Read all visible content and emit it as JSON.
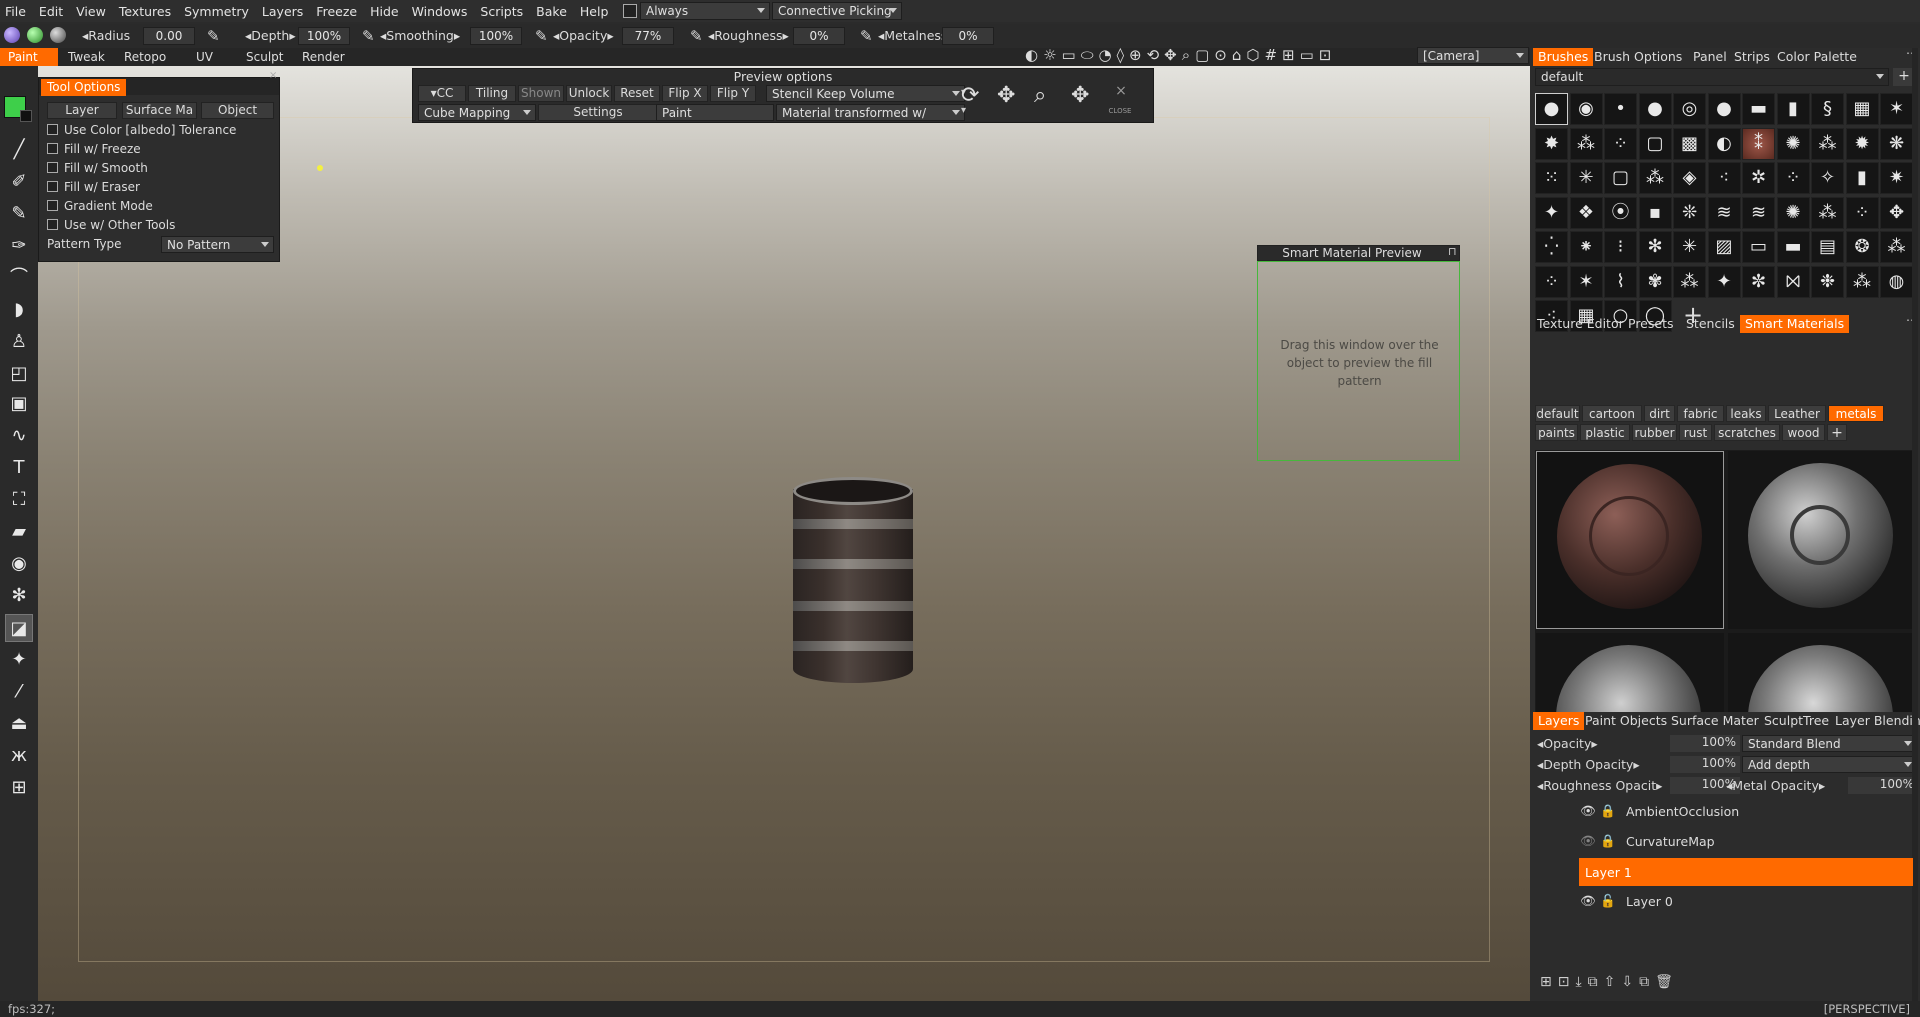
{
  "menu": [
    "File",
    "Edit",
    "View",
    "Textures",
    "Symmetry",
    "Layers",
    "Freeze",
    "Hide",
    "Windows",
    "Scripts",
    "Bake",
    "Help"
  ],
  "always_label": "Always",
  "picking_label": "Connective  Picking",
  "params": {
    "radius_label": "Radius",
    "radius_value": "0.00",
    "depth_label": "Depth",
    "depth_value": "100%",
    "smoothing_label": "Smoothing",
    "smoothing_value": "100%",
    "opacity_label": "Opacity",
    "opacity_value": "77%",
    "roughness_label": "Roughness",
    "roughness_value": "0%",
    "metalness_label": "Metalness",
    "metalness_value": "0%"
  },
  "rooms": [
    "Paint",
    "Tweak",
    "Retopo",
    "UV",
    "Sculpt",
    "Render"
  ],
  "camera_combo": "[Camera]",
  "tool_options": {
    "title": "Tool  Options",
    "tabs": [
      "Layer",
      "Surface  Ma",
      "Object"
    ],
    "options": [
      "Use  Color  [albedo]  Tolerance",
      "Fill  w/  Freeze",
      "Fill  w/  Smooth",
      "Fill  w/  Eraser",
      "Gradient  Mode",
      "Use  w/  Other  Tools"
    ],
    "pattern_label": "Pattern  Type",
    "pattern_value": "No  Pattern"
  },
  "preview_options": {
    "title": "Preview  options",
    "row1": [
      "CC",
      "Tiling",
      "Shown",
      "Unlock",
      "Reset",
      "Flip  X",
      "Flip  Y"
    ],
    "stencil_combo": "Stencil  Keep  Volume",
    "mapping_combo": "Cube  Mapping",
    "settings_btn": "Settings",
    "paint_combo": "Paint",
    "material_combo": "Material  transformed  w/",
    "close_label": "CLOSE"
  },
  "smart_preview": {
    "title": "Smart  Material  Preview",
    "text": "Drag  this  window  over  the  object  to  preview  the  fill  pattern"
  },
  "brushes_tabs": [
    "Brushes",
    "Brush  Options",
    "Panel",
    "Strips",
    "Color  Palette"
  ],
  "brush_preset": "default",
  "materials_tabs": [
    "Texture  Editor",
    "Presets",
    "Stencils",
    "Smart  Materials"
  ],
  "sm_categories_row1": [
    "default",
    "cartoon",
    "dirt",
    "fabric",
    "leaks",
    "Leather",
    "metals"
  ],
  "sm_categories_row2": [
    "paints",
    "plastic",
    "rubber",
    "rust",
    "scratches",
    "wood"
  ],
  "layers_tabs": [
    "Layers",
    "Paint  Objects",
    "Surface  Mater",
    "SculptTree",
    "Layer  Blendin"
  ],
  "layer_props": {
    "opacity_label": "Opacity",
    "opacity_value": "100%",
    "blend_value": "Standard  Blend",
    "depth_label": "Depth  Opacity",
    "depth_value": "100%",
    "depth_mode": "Add  depth",
    "rough_label": "Roughness  Opacit",
    "rough_value": "100%",
    "metal_label": "Metal  Opacity",
    "metal_value": "100%"
  },
  "layers": [
    "AmbientOcclusion",
    "CurvatureMap",
    "Layer  1",
    "Layer  0"
  ],
  "status_left": "fps:327;",
  "status_right": "[PERSPECTIVE]",
  "colors": {
    "accent": "#ff6a00",
    "primary_color": "#3ecf4a"
  },
  "icons": [
    "sphere-icon",
    "camera-icon",
    "eye-icon",
    "lock-icon",
    "plus-icon",
    "close-icon",
    "rotate-icon",
    "move-icon",
    "zoom-icon"
  ]
}
